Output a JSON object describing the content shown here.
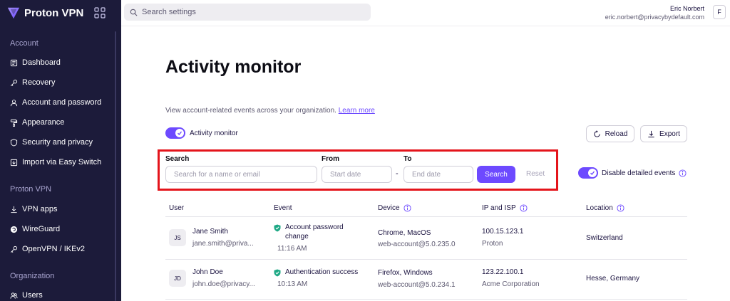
{
  "sidebar": {
    "brand": "Proton VPN",
    "sections": [
      {
        "title": "Account",
        "items": [
          {
            "label": "Dashboard",
            "icon": "dashboard-icon"
          },
          {
            "label": "Recovery",
            "icon": "key-icon"
          },
          {
            "label": "Account and password",
            "icon": "user-icon"
          },
          {
            "label": "Appearance",
            "icon": "paint-roller-icon"
          },
          {
            "label": "Security and privacy",
            "icon": "shield-icon"
          },
          {
            "label": "Import via Easy Switch",
            "icon": "import-icon"
          }
        ]
      },
      {
        "title": "Proton VPN",
        "items": [
          {
            "label": "VPN apps",
            "icon": "download-icon"
          },
          {
            "label": "WireGuard",
            "icon": "wireguard-icon"
          },
          {
            "label": "OpenVPN / IKEv2",
            "icon": "key-icon"
          }
        ]
      },
      {
        "title": "Organization",
        "items": [
          {
            "label": "Users",
            "icon": "users-icon"
          }
        ]
      }
    ]
  },
  "topbar": {
    "search_placeholder": "Search settings",
    "user_name": "Eric Norbert",
    "user_email": "eric.norbert@privacybydefault.com",
    "user_initial": "F"
  },
  "main": {
    "title": "Activity monitor",
    "description": "View account-related events across your organization.",
    "learn_more": "Learn more",
    "activity_toggle_label": "Activity monitor",
    "reload_label": "Reload",
    "export_label": "Export",
    "filters": {
      "search_label": "Search",
      "search_placeholder": "Search for a name or email",
      "from_label": "From",
      "from_placeholder": "Start date",
      "separator": "-",
      "to_label": "To",
      "to_placeholder": "End date",
      "search_button": "Search",
      "reset_button": "Reset"
    },
    "detailed_events_label": "Disable detailed events",
    "accent_color": "#6d4aff",
    "highlight_color": "#e4141b"
  },
  "table": {
    "headers": [
      "User",
      "Event",
      "Device",
      "IP and ISP",
      "Location"
    ],
    "rows": [
      {
        "initials": "JS",
        "name": "Jane Smith",
        "email": "jane.smith@priva...",
        "event_line1": "Account password",
        "event_line2": "change",
        "time": "11:16 AM",
        "device": "Chrome, MacOS",
        "device_sub": "web-account@5.0.235.0",
        "ip": "100.15.123.1",
        "isp": "Proton",
        "location": "Switzerland"
      },
      {
        "initials": "JD",
        "name": "John Doe",
        "email": "john.doe@privacy...",
        "event_line1": "Authentication success",
        "time": "10:13 AM",
        "device": "Firefox, Windows",
        "device_sub": "web-account@5.0.234.1",
        "ip": "123.22.100.1",
        "isp": "Acme Corporation",
        "location": "Hesse, Germany"
      }
    ]
  }
}
